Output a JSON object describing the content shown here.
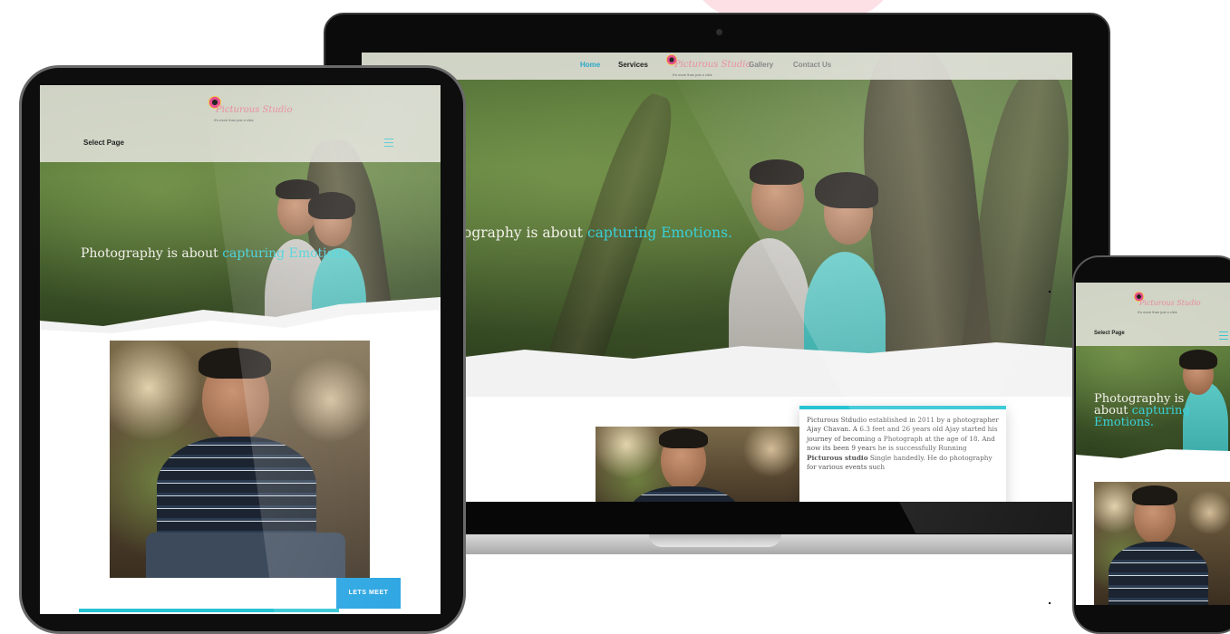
{
  "site": {
    "logo_text": "Picturous Studio",
    "logo_tagline": "It's more than just a click",
    "nav": {
      "home": "Home",
      "services": "Services",
      "gallery": "Gallery",
      "contact": "Contact Us",
      "select_page": "Select Page"
    },
    "hero": {
      "headline_prefix": "Photography is about ",
      "headline_accent": "capturing Emotions.",
      "laptop_prefix": "ography is about ",
      "phone_line1": "Photography is",
      "phone_line2_prefix": "about ",
      "phone_line2_accent": "capturing",
      "phone_line3_accent": "Emotions."
    },
    "about": {
      "paragraph_before": "Picturous Stdudio established in 2011 by a photographer Ajay Chavan. A 6.3 feet and 26 years old Ajay started his journey of becoming a Photograph at the age of 18. And now its been 9 years he is successfully Running ",
      "paragraph_bold": "Picturous studio",
      "paragraph_after": " Single handedly. He do photography for various events such",
      "button_label": "LETS MEET"
    },
    "colors": {
      "accent": "#3ad0d8",
      "button": "#1b9fe0",
      "nav_active": "#2aa9c9"
    }
  }
}
